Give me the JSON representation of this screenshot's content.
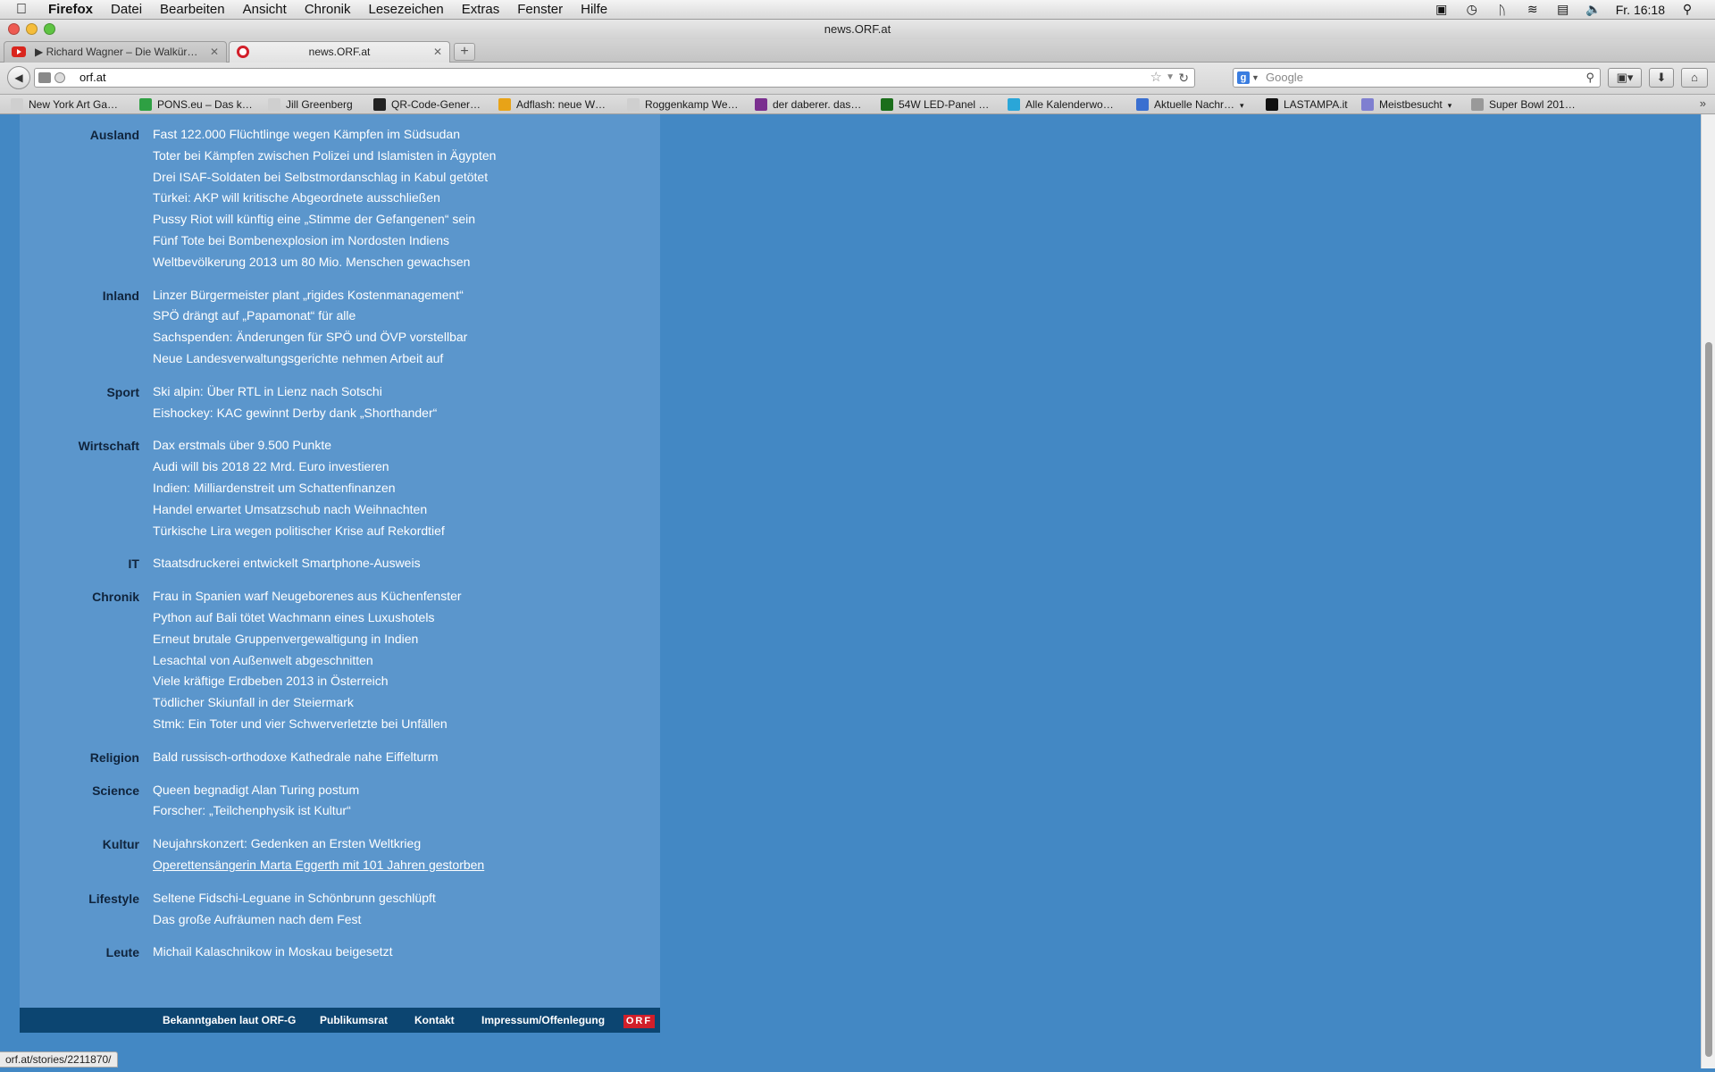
{
  "menubar": {
    "app": "Firefox",
    "items": [
      "Datei",
      "Bearbeiten",
      "Ansicht",
      "Chronik",
      "Lesezeichen",
      "Extras",
      "Fenster",
      "Hilfe"
    ],
    "clock": "Fr. 16:18"
  },
  "window": {
    "title": "news.ORF.at"
  },
  "tabs": [
    {
      "label": "▶ Richard Wagner – Die Walkür…",
      "favicon": "youtube-icon",
      "active": false
    },
    {
      "label": "news.ORF.at",
      "favicon": "orf-icon",
      "active": true
    }
  ],
  "nav": {
    "url": "orf.at",
    "search_engine": "g",
    "search_placeholder": "Google"
  },
  "bookmarks": [
    {
      "label": "New York Art Ga…",
      "icon_color": "#cfcfcf"
    },
    {
      "label": "PONS.eu – Das k…",
      "icon_color": "#2ea043"
    },
    {
      "label": "Jill Greenberg",
      "icon_color": "#cfcfcf"
    },
    {
      "label": "QR-Code-Gener…",
      "icon_color": "#222222"
    },
    {
      "label": "Adflash: neue W…",
      "icon_color": "#e8a317"
    },
    {
      "label": "Roggenkamp We…",
      "icon_color": "#cfcfcf"
    },
    {
      "label": "der daberer. das…",
      "icon_color": "#7a2f8f"
    },
    {
      "label": "54W LED-Panel …",
      "icon_color": "#1b6e1b"
    },
    {
      "label": "Alle Kalenderwo…",
      "icon_color": "#2aa6d8"
    },
    {
      "label": "Aktuelle Nachr…",
      "icon_color": "#3a6fd0"
    },
    {
      "label": "LASTAMPA.it",
      "icon_color": "#111111"
    },
    {
      "label": "Meistbesucht",
      "icon_color": "#7f7fd0"
    },
    {
      "label": "Super Bowl 201…",
      "icon_color": "#999999"
    }
  ],
  "sections": [
    {
      "label": "Ausland",
      "items": [
        "Fast 122.000 Flüchtlinge wegen Kämpfen im Südsudan",
        "Toter bei Kämpfen zwischen Polizei und Islamisten in Ägypten",
        "Drei ISAF-Soldaten bei Selbstmordanschlag in Kabul getötet",
        "Türkei: AKP will kritische Abgeordnete ausschließen",
        "Pussy Riot will künftig eine „Stimme der Gefangenen“ sein",
        "Fünf Tote bei Bombenexplosion im Nordosten Indiens",
        "Weltbevölkerung 2013 um 80 Mio. Menschen gewachsen"
      ]
    },
    {
      "label": "Inland",
      "items": [
        "Linzer Bürgermeister plant „rigides Kostenmanagement“",
        "SPÖ drängt auf „Papamonat“ für alle",
        "Sachspenden: Änderungen für SPÖ und ÖVP vorstellbar",
        "Neue Landesverwaltungsgerichte nehmen Arbeit auf"
      ]
    },
    {
      "label": "Sport",
      "items": [
        "Ski alpin: Über RTL in Lienz nach Sotschi",
        "Eishockey: KAC gewinnt Derby dank „Shorthander“"
      ]
    },
    {
      "label": "Wirtschaft",
      "items": [
        "Dax erstmals über 9.500 Punkte",
        "Audi will bis 2018 22 Mrd. Euro investieren",
        "Indien: Milliardenstreit um Schattenfinanzen",
        "Handel erwartet Umsatzschub nach Weihnachten",
        "Türkische Lira wegen politischer Krise auf Rekordtief"
      ]
    },
    {
      "label": "IT",
      "items": [
        "Staatsdruckerei entwickelt Smartphone-Ausweis"
      ]
    },
    {
      "label": "Chronik",
      "items": [
        "Frau in Spanien warf Neugeborenes aus Küchenfenster",
        "Python auf Bali tötet Wachmann eines Luxushotels",
        "Erneut brutale Gruppenvergewaltigung in Indien",
        "Lesachtal von Außenwelt abgeschnitten",
        "Viele kräftige Erdbeben 2013 in Österreich",
        "Tödlicher Skiunfall in der Steiermark",
        "Stmk: Ein Toter und vier Schwerverletzte bei Unfällen"
      ]
    },
    {
      "label": "Religion",
      "items": [
        "Bald russisch-orthodoxe Kathedrale nahe Eiffelturm"
      ]
    },
    {
      "label": "Science",
      "items": [
        "Queen begnadigt Alan Turing postum",
        "Forscher: „Teilchenphysik ist Kultur“"
      ]
    },
    {
      "label": "Kultur",
      "items": [
        "Neujahrskonzert: Gedenken an Ersten Weltkrieg",
        "Operettensängerin Marta Eggerth mit 101 Jahren gestorben"
      ],
      "hover_index": 1
    },
    {
      "label": "Lifestyle",
      "items": [
        "Seltene Fidschi-Leguane in Schönbrunn geschlüpft",
        "Das große Aufräumen nach dem Fest"
      ]
    },
    {
      "label": "Leute",
      "items": [
        "Michail Kalaschnikow in Moskau beigesetzt"
      ]
    }
  ],
  "footer": {
    "links": [
      "Bekanntgaben laut ORF-G",
      "Publikumsrat",
      "Kontakt",
      "Impressum/Offenlegung"
    ],
    "logo": "ORF"
  },
  "status": "orf.at/stories/2211870/"
}
